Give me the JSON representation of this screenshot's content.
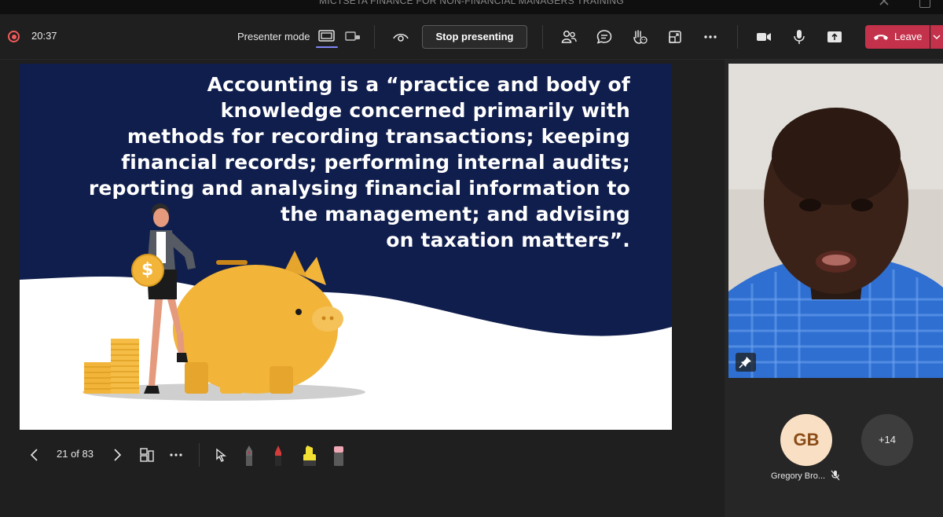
{
  "window": {
    "title": "MICTSETA FINANCE FOR NON-FINANCIAL MANAGERS TRAINING"
  },
  "toolbar": {
    "timer": "20:37",
    "presenter_mode_label": "Presenter mode",
    "stop_presenting_label": "Stop presenting",
    "leave_label": "Leave",
    "icons": [
      "record-icon",
      "presenter-mode-standout-icon",
      "presenter-mode-side-by-side-icon",
      "eye-icon",
      "people-icon",
      "chat-icon",
      "reactions-icon",
      "share-tray-icon",
      "more-options-icon",
      "camera-icon",
      "mic-icon",
      "share-content-icon",
      "phone-hangup-icon",
      "chevron-down-icon"
    ]
  },
  "slide": {
    "lines": [
      "Accounting is a “practice and body of",
      "knowledge concerned primarily with",
      "methods for recording transactions; keeping",
      "financial records; performing internal audits;",
      "reporting and analysing financial information to",
      "the management; and advising",
      "on taxation matters”."
    ],
    "coin_symbol": "$",
    "colors": {
      "navy": "#101e4d",
      "gold": "#f2b53a",
      "white": "#ffffff"
    }
  },
  "slide_nav": {
    "counter": "21 of 83",
    "icons": [
      "prev-slide-icon",
      "next-slide-icon",
      "grid-view-icon",
      "more-options-icon",
      "laser-pointer-icon",
      "pen-icon",
      "red-pen-icon",
      "highlighter-icon",
      "eraser-icon"
    ]
  },
  "participants": {
    "avatar_initials": "GB",
    "avatar_name": "Gregory Bro...",
    "more_count": "+14"
  }
}
